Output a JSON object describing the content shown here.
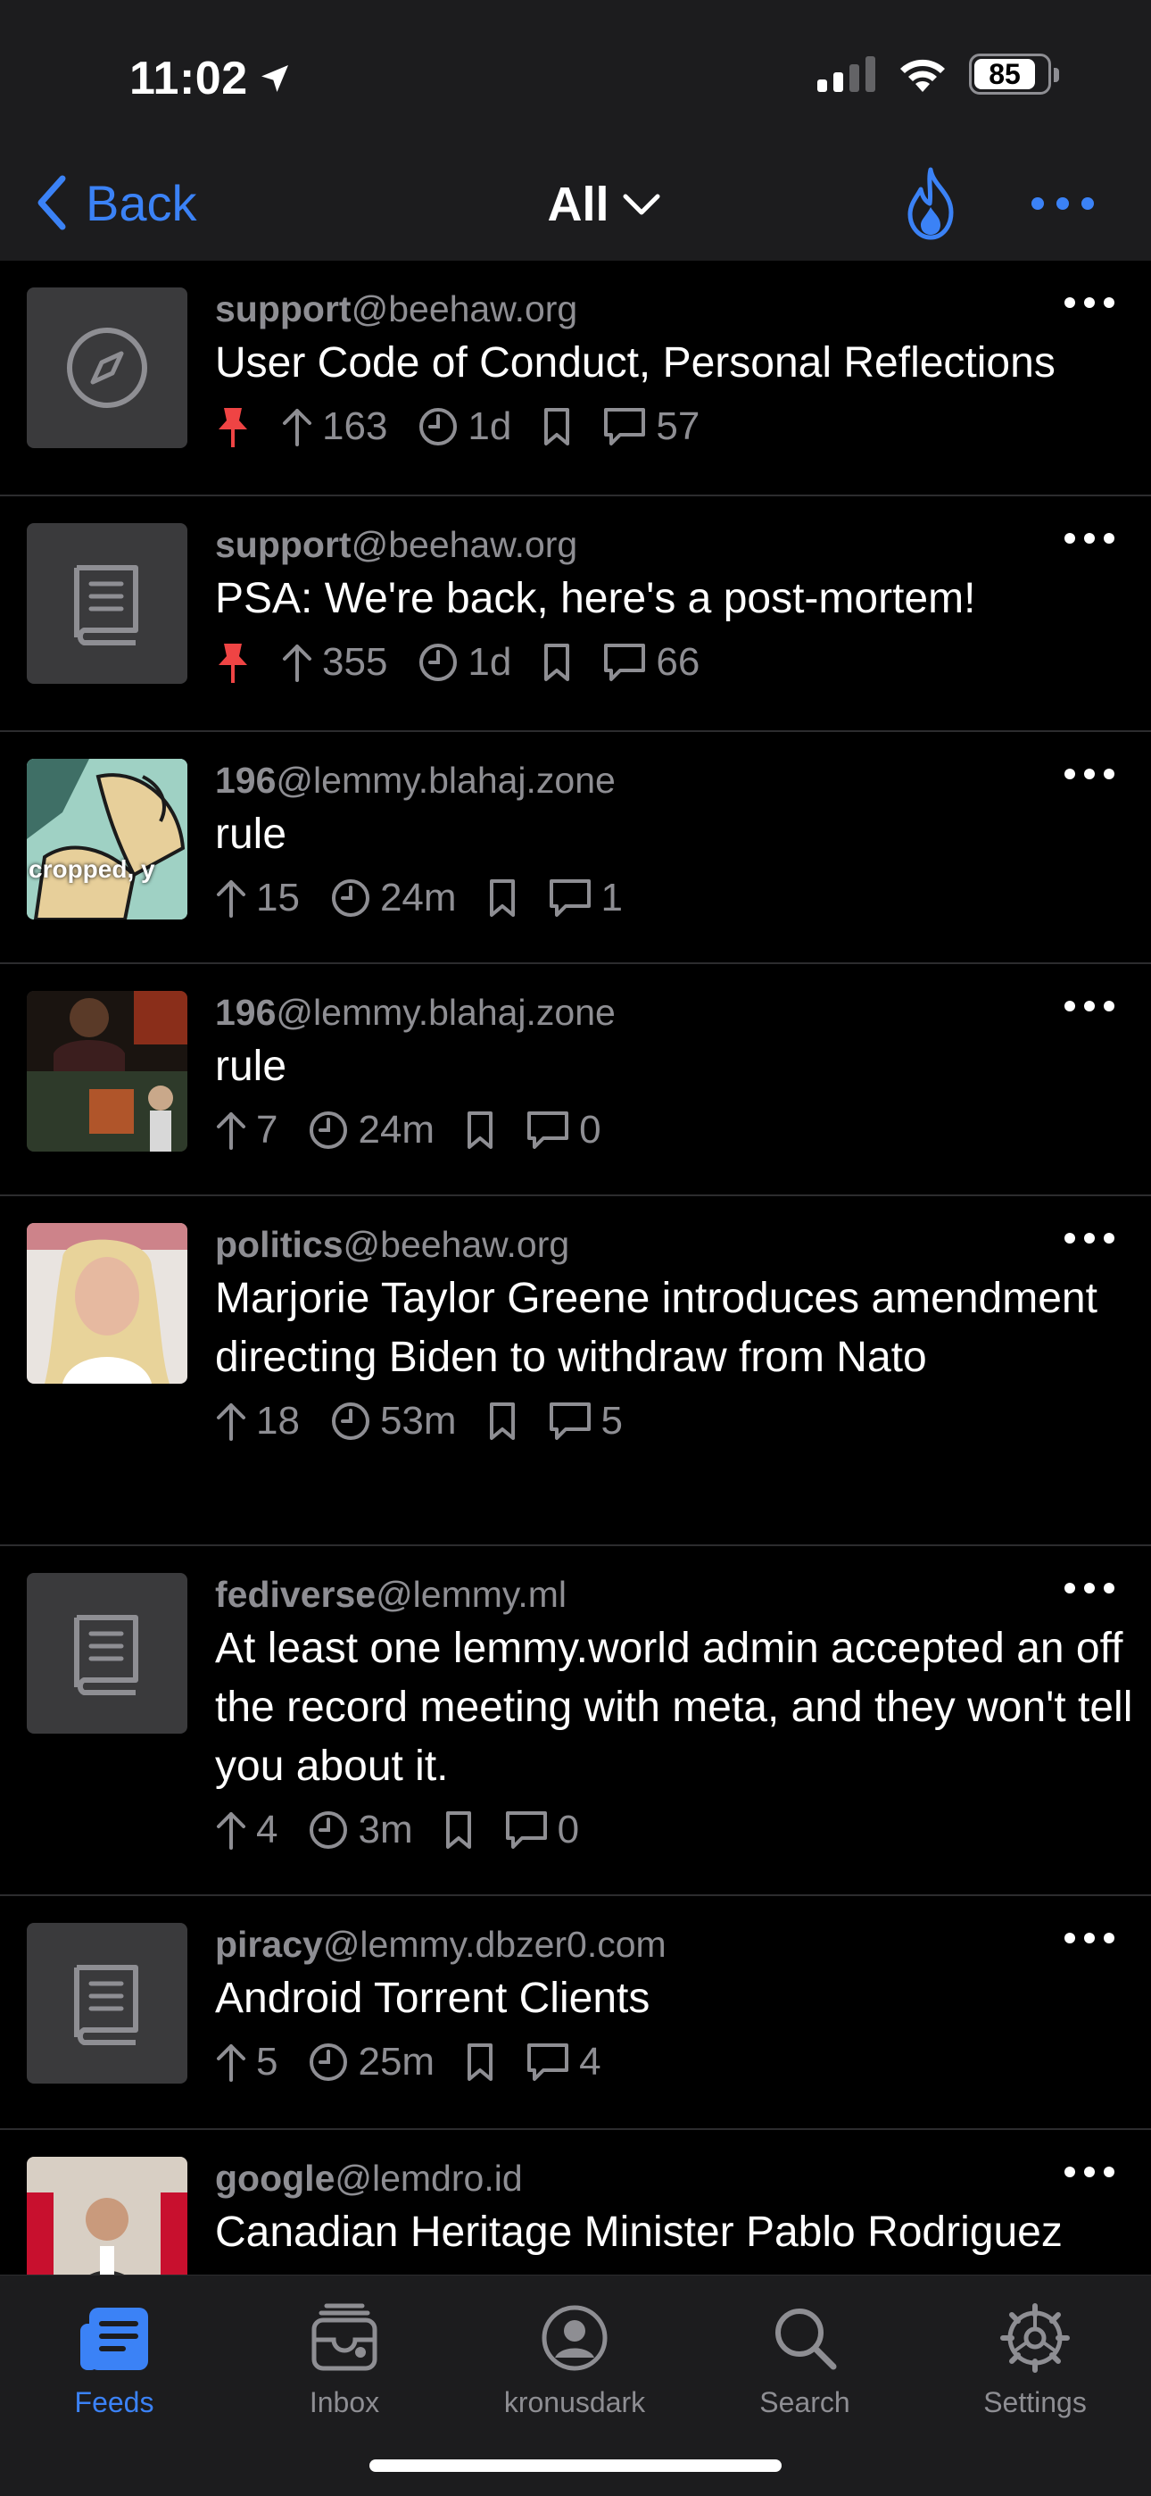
{
  "status": {
    "time": "11:02",
    "battery": "85",
    "battery_level": 0.85
  },
  "nav": {
    "back_label": "Back",
    "title": "All"
  },
  "colors": {
    "accent": "#3b82f6",
    "pin": "#ef4444",
    "background": "#000000",
    "bar": "#1c1c1e",
    "muted": "#8e8e93"
  },
  "posts": [
    {
      "community": "support",
      "instance": "@beehaw.org",
      "title": "User Code of Conduct, Personal Reflections",
      "pinned": true,
      "score": "163",
      "age": "1d",
      "comments": "57",
      "thumb_icon": "compass-icon"
    },
    {
      "community": "support",
      "instance": "@beehaw.org",
      "title": "PSA: We're back, here's a post-mortem!",
      "pinned": true,
      "score": "355",
      "age": "1d",
      "comments": "66",
      "thumb_icon": "book-icon"
    },
    {
      "community": "196",
      "instance": "@lemmy.blahaj.zone",
      "title": "rule",
      "pinned": false,
      "score": "15",
      "age": "24m",
      "comments": "1",
      "thumb_icon": "image-thumbnail",
      "thumb_text": "cropped, y"
    },
    {
      "community": "196",
      "instance": "@lemmy.blahaj.zone",
      "title": "rule",
      "pinned": false,
      "score": "7",
      "age": "24m",
      "comments": "0",
      "thumb_icon": "image-thumbnail"
    },
    {
      "community": "politics",
      "instance": "@beehaw.org",
      "title": "Marjorie Taylor Greene introduces amendment directing Biden to withdraw from Nato",
      "pinned": false,
      "score": "18",
      "age": "53m",
      "comments": "5",
      "thumb_icon": "image-thumbnail"
    },
    {
      "community": "fediverse",
      "instance": "@lemmy.ml",
      "title": "At least one lemmy.world admin accepted an off the record meeting with meta, and they won't tell you about it.",
      "pinned": false,
      "score": "4",
      "age": "3m",
      "comments": "0",
      "thumb_icon": "book-icon"
    },
    {
      "community": "piracy",
      "instance": "@lemmy.dbzer0.com",
      "title": "Android Torrent Clients",
      "pinned": false,
      "score": "5",
      "age": "25m",
      "comments": "4",
      "thumb_icon": "book-icon"
    },
    {
      "community": "google",
      "instance": "@lemdro.id",
      "title": "Canadian Heritage Minister Pablo Rodriguez",
      "pinned": false,
      "score": "",
      "age": "",
      "comments": "",
      "thumb_icon": "image-thumbnail"
    }
  ],
  "tabs": [
    {
      "label": "Feeds",
      "icon": "feeds-icon",
      "active": true
    },
    {
      "label": "Inbox",
      "icon": "inbox-icon",
      "active": false
    },
    {
      "label": "kronusdark",
      "icon": "profile-icon",
      "active": false
    },
    {
      "label": "Search",
      "icon": "search-icon",
      "active": false
    },
    {
      "label": "Settings",
      "icon": "gear-icon",
      "active": false
    }
  ]
}
